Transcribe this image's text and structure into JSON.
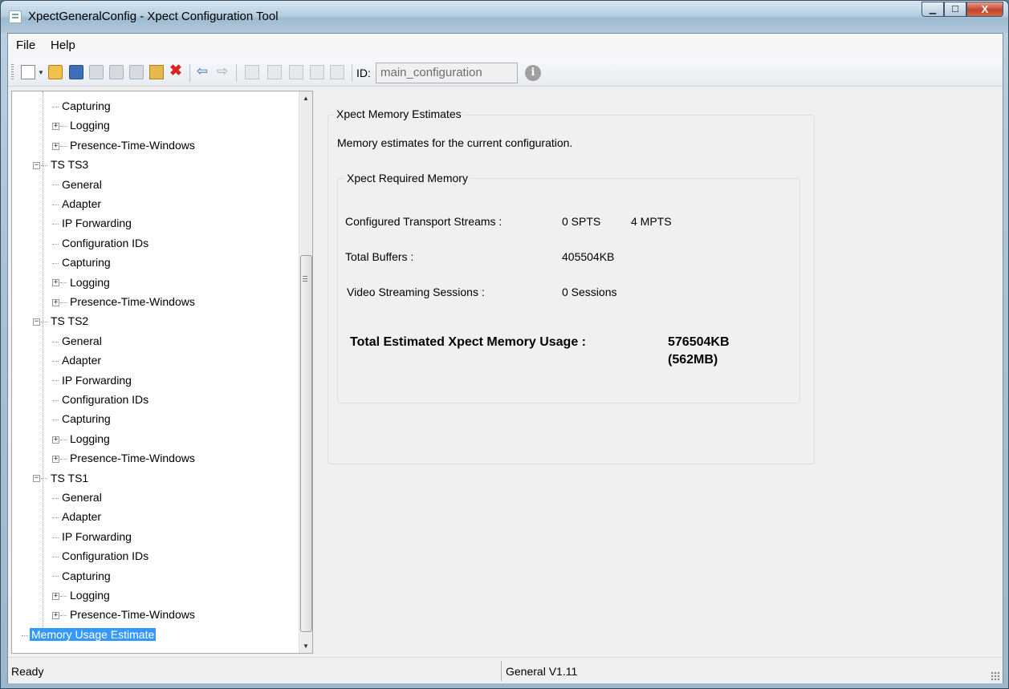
{
  "window": {
    "title": "XpectGeneralConfig - Xpect Configuration Tool",
    "minimize": "▁",
    "maximize": "☐",
    "close": "X"
  },
  "menu": {
    "file": "File",
    "help": "Help"
  },
  "toolbar": {
    "id_label": "ID:",
    "id_value": "main_configuration",
    "info_glyph": "i",
    "delete_glyph": "✖",
    "back_glyph": "⇦",
    "forward_glyph": "⇨"
  },
  "tree": {
    "items": [
      {
        "label": "Capturing",
        "depth": 2,
        "expander": ""
      },
      {
        "label": "Logging",
        "depth": 2,
        "expander": "+"
      },
      {
        "label": "Presence-Time-Windows",
        "depth": 2,
        "expander": "+"
      },
      {
        "label": "TS TS3",
        "depth": 1,
        "expander": "−"
      },
      {
        "label": "General",
        "depth": 2,
        "expander": ""
      },
      {
        "label": "Adapter",
        "depth": 2,
        "expander": ""
      },
      {
        "label": "IP Forwarding",
        "depth": 2,
        "expander": ""
      },
      {
        "label": "Configuration IDs",
        "depth": 2,
        "expander": ""
      },
      {
        "label": "Capturing",
        "depth": 2,
        "expander": ""
      },
      {
        "label": "Logging",
        "depth": 2,
        "expander": "+"
      },
      {
        "label": "Presence-Time-Windows",
        "depth": 2,
        "expander": "+"
      },
      {
        "label": "TS TS2",
        "depth": 1,
        "expander": "−"
      },
      {
        "label": "General",
        "depth": 2,
        "expander": ""
      },
      {
        "label": "Adapter",
        "depth": 2,
        "expander": ""
      },
      {
        "label": "IP Forwarding",
        "depth": 2,
        "expander": ""
      },
      {
        "label": "Configuration IDs",
        "depth": 2,
        "expander": ""
      },
      {
        "label": "Capturing",
        "depth": 2,
        "expander": ""
      },
      {
        "label": "Logging",
        "depth": 2,
        "expander": "+"
      },
      {
        "label": "Presence-Time-Windows",
        "depth": 2,
        "expander": "+"
      },
      {
        "label": "TS TS1",
        "depth": 1,
        "expander": "−"
      },
      {
        "label": "General",
        "depth": 2,
        "expander": ""
      },
      {
        "label": "Adapter",
        "depth": 2,
        "expander": ""
      },
      {
        "label": "IP Forwarding",
        "depth": 2,
        "expander": ""
      },
      {
        "label": "Configuration IDs",
        "depth": 2,
        "expander": ""
      },
      {
        "label": "Capturing",
        "depth": 2,
        "expander": ""
      },
      {
        "label": "Logging",
        "depth": 2,
        "expander": "+"
      },
      {
        "label": "Presence-Time-Windows",
        "depth": 2,
        "expander": "+"
      },
      {
        "label": "Memory Usage Estimate",
        "depth": 0,
        "expander": "",
        "selected": true
      }
    ]
  },
  "estimates": {
    "group_title": "Xpect Memory Estimates",
    "description": "Memory estimates for the current configuration.",
    "inner_title": "Xpect Required Memory",
    "streams_label": "Configured Transport Streams :",
    "spts": "0 SPTS",
    "mpts": "4 MPTS",
    "buffers_label": "Total Buffers :",
    "buffers_value": "405504KB",
    "sessions_label": "Video Streaming Sessions :",
    "sessions_value": "0 Sessions",
    "total_label": "Total Estimated Xpect Memory Usage :",
    "total_kb": "576504KB",
    "total_mb": "(562MB)"
  },
  "status": {
    "left": "Ready",
    "right": "General V1.11"
  }
}
